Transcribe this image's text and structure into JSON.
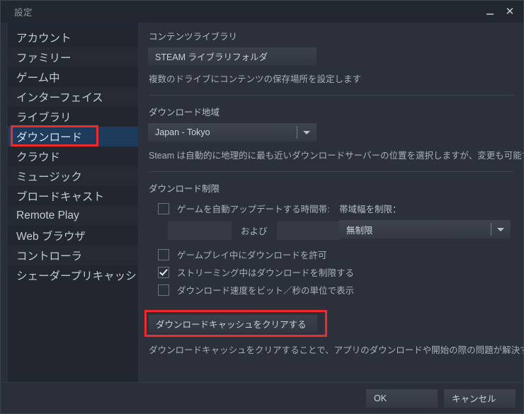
{
  "window": {
    "title": "設定",
    "minimize_label": "_",
    "close_label": "✕"
  },
  "sidebar": {
    "items": [
      {
        "label": "アカウント",
        "selected": false
      },
      {
        "label": "ファミリー",
        "selected": false
      },
      {
        "label": "ゲーム中",
        "selected": false
      },
      {
        "label": "インターフェイス",
        "selected": false
      },
      {
        "label": "ライブラリ",
        "selected": false
      },
      {
        "label": "ダウンロード",
        "selected": true
      },
      {
        "label": "クラウド",
        "selected": false
      },
      {
        "label": "ミュージック",
        "selected": false
      },
      {
        "label": "ブロードキャスト",
        "selected": false
      },
      {
        "label": "Remote Play",
        "selected": false
      },
      {
        "label": "Web ブラウザ",
        "selected": false
      },
      {
        "label": "コントローラ",
        "selected": false
      },
      {
        "label": "シェーダープリキャッシュ",
        "selected": false
      }
    ]
  },
  "content": {
    "content_library": {
      "heading": "コンテンツライブラリ",
      "button_label": "STEAM ライブラリフォルダ",
      "description": "複数のドライブにコンテンツの保存場所を設定します"
    },
    "download_region": {
      "heading": "ダウンロード地域",
      "selected": "Japan - Tokyo",
      "description": "Steam は自動的に地理的に最も近いダウンロードサーバーの位置を選択しますが、変更も可能です。"
    },
    "download_restrictions": {
      "heading": "ダウンロード制限",
      "auto_update_window": {
        "label": "ゲームを自動アップデートする時間帯:",
        "checked": false,
        "start_value": "",
        "between_label": "および",
        "end_value": ""
      },
      "bandwidth": {
        "label": "帯域幅を制限：",
        "selected": "無制限"
      },
      "checkboxes": [
        {
          "label": "ゲームプレイ中にダウンロードを許可",
          "checked": false
        },
        {
          "label": "ストリーミング中はダウンロードを制限する",
          "checked": true
        },
        {
          "label": "ダウンロード速度をビット／秒の単位で表示",
          "checked": false
        }
      ]
    },
    "cache": {
      "button_label": "ダウンロードキャッシュをクリアする",
      "description": "ダウンロードキャッシュをクリアすることで、アプリのダウンロードや開始の際の問題が解決する場合があります。"
    }
  },
  "footer": {
    "ok_label": "OK",
    "cancel_label": "キャンセル"
  },
  "colors": {
    "accent_selected": "#1f3b5c",
    "annotation_red": "#ee2b2b",
    "window_bg": "#2b303a",
    "sidebar_bg": "#22262e"
  }
}
